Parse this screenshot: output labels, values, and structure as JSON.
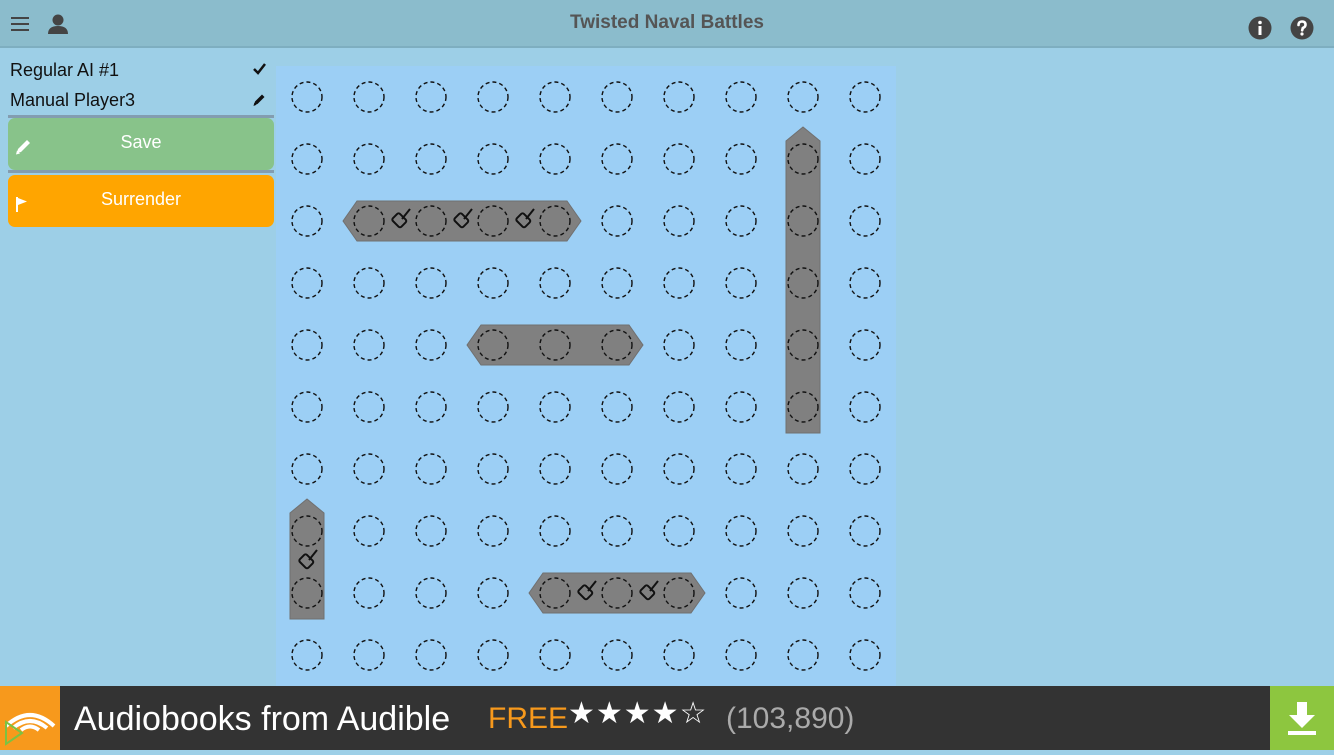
{
  "app": {
    "title": "Twisted Naval Battles"
  },
  "header": {
    "menu_icon": "hamburger-icon",
    "profile_icon": "person-icon",
    "info_icon": "info-icon",
    "help_icon": "help-icon"
  },
  "sidebar": {
    "players": [
      {
        "name": "Regular AI #1",
        "icon": "check-icon"
      },
      {
        "name": "Manual Player3",
        "icon": "pencil-icon"
      }
    ],
    "save_label": "Save",
    "surrender_label": "Surrender"
  },
  "board": {
    "rows": 10,
    "cols": 10,
    "ships": [
      {
        "kind": "battleship",
        "row": 2,
        "col": 1,
        "length": 4,
        "orientation": "horizontal"
      },
      {
        "kind": "carrier",
        "row": 1,
        "col": 8,
        "length": 5,
        "orientation": "vertical"
      },
      {
        "kind": "submarine",
        "row": 4,
        "col": 3,
        "length": 3,
        "orientation": "horizontal"
      },
      {
        "kind": "destroyer",
        "row": 7,
        "col": 0,
        "length": 2,
        "orientation": "vertical"
      },
      {
        "kind": "cruiser",
        "row": 8,
        "col": 4,
        "length": 3,
        "orientation": "horizontal"
      }
    ]
  },
  "ad": {
    "text": "Audiobooks from Audible",
    "free": "FREE",
    "rating": 4,
    "stars": "★★★★☆",
    "reviews": "(103,890)"
  },
  "colors": {
    "background": "#9dcfe7",
    "board": "#9ccff5",
    "ship": "#808080",
    "save": "#88c38a",
    "surrender": "#ffa500",
    "audible": "#f7991c",
    "download": "#8dc63f"
  }
}
